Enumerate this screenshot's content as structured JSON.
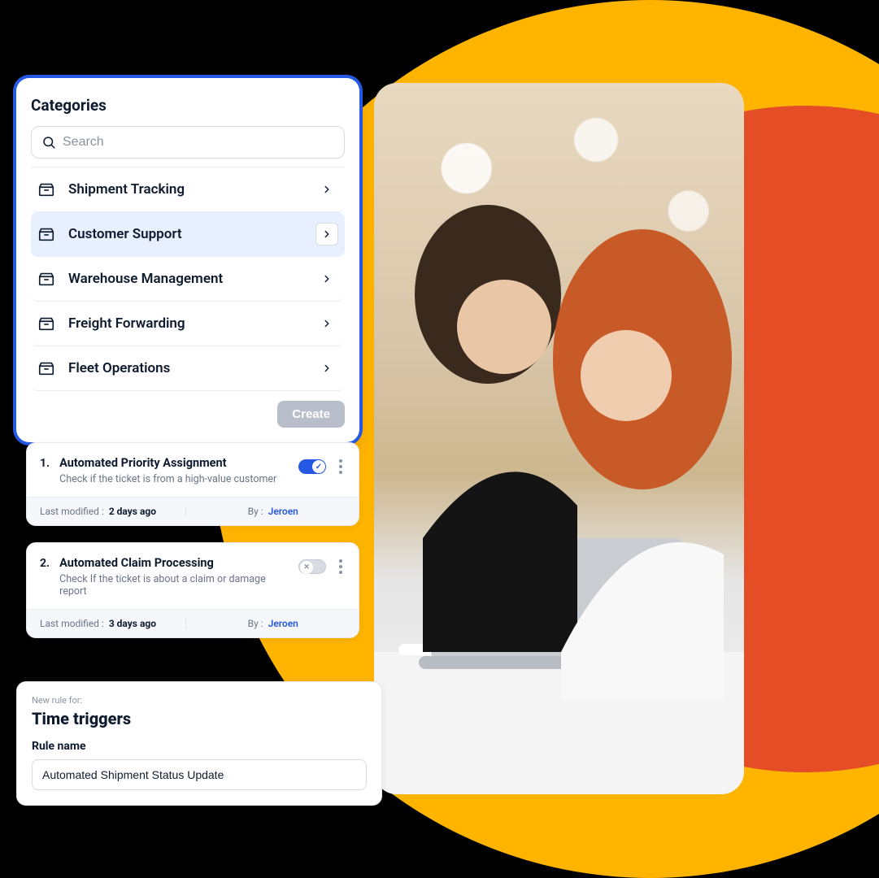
{
  "colors": {
    "accent": "#2558e5",
    "orange": "#e44d26",
    "yellow": "#ffb400"
  },
  "categories": {
    "title": "Categories",
    "search_placeholder": "Search",
    "create_label": "Create",
    "items": [
      {
        "label": "Shipment Tracking",
        "selected": false
      },
      {
        "label": "Customer Support",
        "selected": true
      },
      {
        "label": "Warehouse Management",
        "selected": false
      },
      {
        "label": "Freight Forwarding",
        "selected": false
      },
      {
        "label": "Fleet Operations",
        "selected": false
      }
    ]
  },
  "rules": [
    {
      "num": "1.",
      "title": "Automated Priority Assignment",
      "sub": "Check if the ticket is from a high-value customer",
      "toggle_on": true,
      "modified_label": "Last modified :",
      "modified_value": "2 days ago",
      "by_label": "By :",
      "by_user": "Jeroen"
    },
    {
      "num": "2.",
      "title": "Automated Claim Processing",
      "sub": "Check If the ticket is about a claim or damage report",
      "toggle_on": false,
      "modified_label": "Last modified :",
      "modified_value": "3 days ago",
      "by_label": "By :",
      "by_user": "Jeroen"
    }
  ],
  "new_rule": {
    "eyebrow": "New rule for:",
    "heading": "Time triggers",
    "name_label": "Rule name",
    "name_value": "Automated Shipment Status Update"
  },
  "photo_alt": "Two colleagues laughing together at a desk with a laptop"
}
